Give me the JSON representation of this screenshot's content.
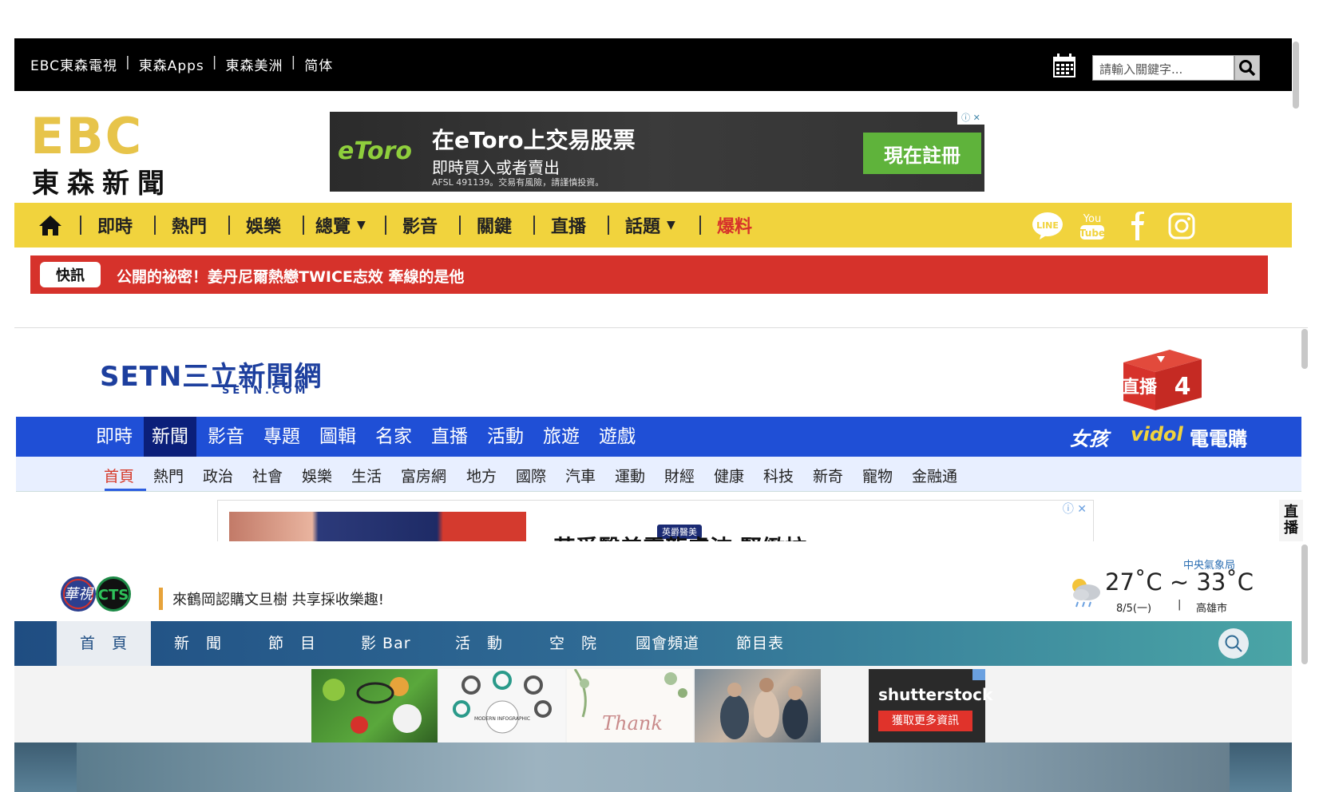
{
  "ebc": {
    "top_links": [
      "EBC東森電視",
      "東森Apps",
      "東森美洲",
      "简体"
    ],
    "search_placeholder": "請輸入關鍵字...",
    "logo_text": "EBC",
    "logo_sub": "東森新聞",
    "ad": {
      "brand": "eToro",
      "title": "在eToro上交易股票",
      "subtitle": "即時買入或者賣出",
      "legal": "AFSL 491139。交易有風險，請謹慎投資。",
      "cta": "現在註冊"
    },
    "nav": [
      "即時",
      "熱門",
      "娛樂",
      "總覽",
      "影音",
      "關鍵",
      "直播",
      "話題",
      "爆料"
    ],
    "social_icons": [
      "line-icon",
      "youtube-icon",
      "facebook-icon",
      "instagram-icon"
    ],
    "flash_label": "快訊",
    "flash_text": "公開的祕密！姜丹尼爾熱戀TWICE志效 牽線的是他",
    "colors": {
      "nav_bg": "#f1d33d",
      "flash_bg": "#d6322b",
      "highlight": "#d6322b"
    }
  },
  "setn": {
    "logo_text": "SETN三立新聞網",
    "logo_sub": "SETN.COM",
    "live_badge": "直播",
    "live_number": "4",
    "nav": [
      "即時",
      "新聞",
      "影音",
      "專題",
      "圖輯",
      "名家",
      "直播",
      "活動",
      "旅遊",
      "遊戲"
    ],
    "nav_active": "新聞",
    "brands": [
      "女孩",
      "vidol",
      "電電購"
    ],
    "subnav": [
      "首頁",
      "熱門",
      "政治",
      "社會",
      "娛樂",
      "生活",
      "富房網",
      "地方",
      "國際",
      "汽車",
      "運動",
      "財經",
      "健康",
      "科技",
      "新奇",
      "寵物",
      "金融通"
    ],
    "subnav_active": "首頁",
    "ad_badge": "英爵醫美",
    "ad_text": "英爵醫美靈龍膚波 緊緻拉",
    "side_live": "直播",
    "colors": {
      "nav_bg": "#1f4fd6",
      "nav_active": "#0b1f7a",
      "subnav_bg": "#e8efff"
    }
  },
  "cts": {
    "logo_text": "華視 CTS",
    "tagline": "來鶴岡認購文旦樹 共享採收樂趣!",
    "weather": {
      "source": "中央氣象局",
      "temp": "27˚C ~ 33˚C",
      "date": "8/5(一)",
      "separator": "|",
      "city": "高雄市"
    },
    "nav": [
      "首　頁",
      "新　聞",
      "節　目",
      "影 Bar",
      "活　動",
      "空　院",
      "國會頻道",
      "節目表"
    ],
    "nav_active": "首　頁",
    "ad_tiles": [
      "sports-photo",
      "modern-infographic",
      "thank-you-card",
      "fitness-photo"
    ],
    "ad_tile_caption": "MODERN INFOGRAPHIC",
    "ad_tile_script": "Thank",
    "ad_shutter": {
      "brand": "shutterstock",
      "cta": "獲取更多資訊"
    }
  }
}
